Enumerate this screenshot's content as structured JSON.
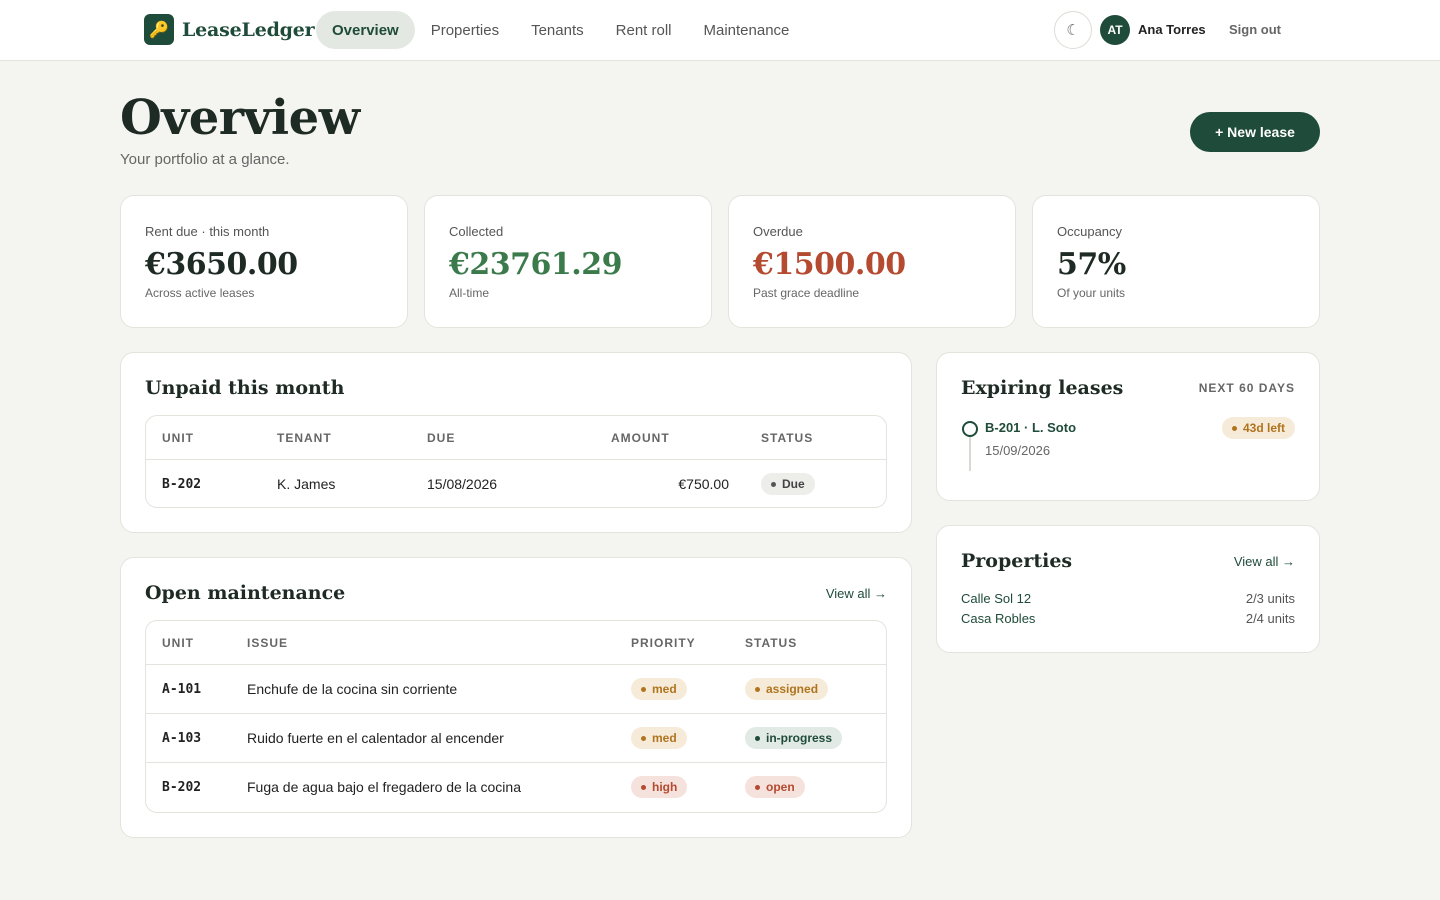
{
  "app": {
    "brand": "LeaseLedger",
    "logo_glyph": "🔑"
  },
  "nav": {
    "items": [
      {
        "label": "Overview",
        "active": true
      },
      {
        "label": "Properties",
        "active": false
      },
      {
        "label": "Tenants",
        "active": false
      },
      {
        "label": "Rent roll",
        "active": false
      },
      {
        "label": "Maintenance",
        "active": false
      }
    ],
    "theme_icon": "☾",
    "user_initials": "AT",
    "user_name": "Ana Torres",
    "signout": "Sign out"
  },
  "header": {
    "title": "Overview",
    "subtitle": "Your portfolio at a glance.",
    "new_lease": "+ New lease"
  },
  "stats": [
    {
      "label": "Rent due · this month",
      "value": "€3650.00",
      "note": "Across active leases",
      "tone": "default"
    },
    {
      "label": "Collected",
      "value": "€23761.29",
      "note": "All-time",
      "tone": "green"
    },
    {
      "label": "Overdue",
      "value": "€1500.00",
      "note": "Past grace deadline",
      "tone": "red"
    },
    {
      "label": "Occupancy",
      "value": "57%",
      "note": "Of your units",
      "tone": "default"
    }
  ],
  "unpaid": {
    "title": "Unpaid this month",
    "columns": {
      "unit": "UNIT",
      "tenant": "TENANT",
      "due": "DUE",
      "amount": "AMOUNT",
      "status": "STATUS"
    },
    "rows": [
      {
        "unit": "B-202",
        "tenant": "K. James",
        "due": "15/08/2026",
        "amount": "€750.00",
        "status": "Due"
      }
    ]
  },
  "maintenance": {
    "title": "Open maintenance",
    "view_all": "View all →",
    "columns": {
      "unit": "UNIT",
      "issue": "ISSUE",
      "priority": "PRIORITY",
      "status": "STATUS"
    },
    "rows": [
      {
        "unit": "A-101",
        "issue": "Enchufe de la cocina sin corriente",
        "priority": "med",
        "status": "assigned"
      },
      {
        "unit": "A-103",
        "issue": "Ruido fuerte en el calentador al encender",
        "priority": "med",
        "status": "in-progress"
      },
      {
        "unit": "B-202",
        "issue": "Fuga de agua bajo el fregadero de la cocina",
        "priority": "high",
        "status": "open"
      }
    ]
  },
  "expiring": {
    "title": "Expiring leases",
    "range": "NEXT 60 DAYS",
    "items": [
      {
        "label": "B-201 · L. Soto",
        "date": "15/09/2026",
        "badge": "43d left"
      }
    ]
  },
  "properties": {
    "title": "Properties",
    "view_all": "View all →",
    "items": [
      {
        "name": "Calle Sol 12",
        "units": "2/3 units"
      },
      {
        "name": "Casa Robles",
        "units": "2/4 units"
      }
    ]
  },
  "colors": {
    "brand": "#1f4b3a",
    "background": "#f4f4f0",
    "positive": "#3b7a4b",
    "negative": "#b44a30",
    "warning": "#b0741f"
  }
}
